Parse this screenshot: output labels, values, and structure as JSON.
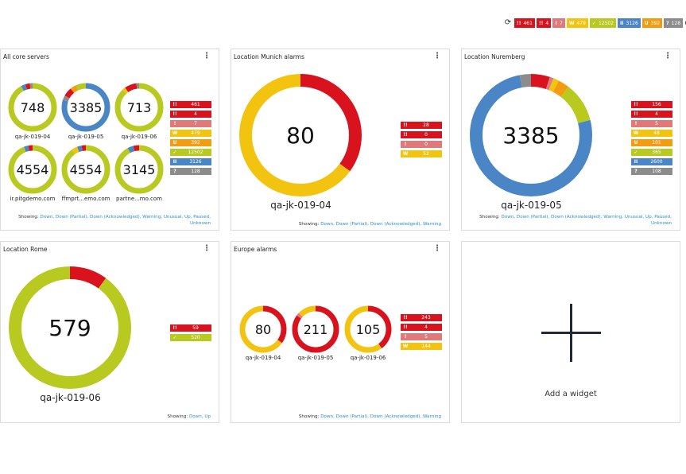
{
  "colors": {
    "down": "#d9131e",
    "partial": "#d9131e",
    "ack": "#e07a7a",
    "warning": "#f2c30f",
    "unusual": "#f39c12",
    "up": "#b8c920",
    "paused": "#4a86c5",
    "unknown": "#8c8c8c"
  },
  "topbar": {
    "refresh_icon": "refresh-icon",
    "counts": [
      {
        "glyph": "!!",
        "value": "461",
        "color": "#d9131e"
      },
      {
        "glyph": "!!",
        "value": "4",
        "color": "#d9131e"
      },
      {
        "glyph": "!",
        "value": "7",
        "color": "#e07a7a"
      },
      {
        "glyph": "W",
        "value": "479",
        "color": "#f2c30f"
      },
      {
        "glyph": "✓",
        "value": "12502",
        "color": "#b8c920"
      },
      {
        "glyph": "II",
        "value": "3126",
        "color": "#4a86c5"
      },
      {
        "glyph": "U",
        "value": "392",
        "color": "#f39c12"
      },
      {
        "glyph": "?",
        "value": "128",
        "color": "#8c8c8c"
      }
    ]
  },
  "widgets": {
    "core": {
      "title": "All core servers",
      "donuts": [
        {
          "value": "748",
          "label": "qa-jk-019-04",
          "segments": [
            [
              "#b8c920",
              92
            ],
            [
              "#4a86c5",
              3
            ],
            [
              "#d9131e",
              3
            ],
            [
              "#8c8c8c",
              2
            ]
          ]
        },
        {
          "value": "3385",
          "label": "qa-jk-019-05",
          "segments": [
            [
              "#4a86c5",
              80
            ],
            [
              "#8c8c8c",
              3
            ],
            [
              "#d9131e",
              6
            ],
            [
              "#f39c12",
              4
            ],
            [
              "#b8c920",
              7
            ]
          ]
        },
        {
          "value": "713",
          "label": "qa-jk-019-06",
          "segments": [
            [
              "#b8c920",
              88
            ],
            [
              "#f2c30f",
              2
            ],
            [
              "#d9131e",
              8
            ],
            [
              "#8c8c8c",
              2
            ]
          ]
        },
        {
          "value": "4554",
          "label": "ir.pitgdemo.com",
          "segments": [
            [
              "#b8c920",
              94
            ],
            [
              "#4a86c5",
              3
            ],
            [
              "#d9131e",
              3
            ]
          ]
        },
        {
          "value": "4554",
          "label": "ffmprt...emo.com",
          "segments": [
            [
              "#b8c920",
              90
            ],
            [
              "#f2c30f",
              4
            ],
            [
              "#4a86c5",
              3
            ],
            [
              "#d9131e",
              3
            ]
          ]
        },
        {
          "value": "3145",
          "label": "partne...mo.com",
          "segments": [
            [
              "#b8c920",
              92
            ],
            [
              "#4a86c5",
              4
            ],
            [
              "#d9131e",
              4
            ]
          ]
        }
      ],
      "legend": [
        {
          "glyph": "!!",
          "value": "461",
          "color": "#d9131e"
        },
        {
          "glyph": "!!",
          "value": "4",
          "color": "#d9131e"
        },
        {
          "glyph": "!",
          "value": "7",
          "color": "#e07a7a"
        },
        {
          "glyph": "W",
          "value": "479",
          "color": "#f2c30f"
        },
        {
          "glyph": "U",
          "value": "392",
          "color": "#f39c12"
        },
        {
          "glyph": "✓",
          "value": "12502",
          "color": "#b8c920"
        },
        {
          "glyph": "II",
          "value": "3126",
          "color": "#4a86c5"
        },
        {
          "glyph": "?",
          "value": "128",
          "color": "#8c8c8c"
        }
      ],
      "showing_prefix": "Showing: ",
      "showing_filters": "Down, Down (Partial), Down (Acknowledged), Warning, Unusual, Up, Paused, Unknown"
    },
    "munich": {
      "title": "Location Munich alarms",
      "value": "80",
      "label": "qa-jk-019-04",
      "segments": [
        [
          "#d9131e",
          35
        ],
        [
          "#f2c30f",
          65
        ]
      ],
      "legend": [
        {
          "glyph": "!!",
          "value": "28",
          "color": "#d9131e"
        },
        {
          "glyph": "!!",
          "value": "0",
          "color": "#d9131e"
        },
        {
          "glyph": "!",
          "value": "0",
          "color": "#e07a7a"
        },
        {
          "glyph": "W",
          "value": "52",
          "color": "#f2c30f"
        }
      ],
      "showing_prefix": "Showing: ",
      "showing_filters": "Down, Down (Partial), Down (Acknowledged), Warning"
    },
    "nuremberg": {
      "title": "Location Nuremberg",
      "value": "3385",
      "label": "qa-jk-019-05",
      "segments": [
        [
          "#d9131e",
          5
        ],
        [
          "#e07a7a",
          1
        ],
        [
          "#f2c30f",
          1.5
        ],
        [
          "#f39c12",
          3
        ],
        [
          "#b8c920",
          10.5
        ],
        [
          "#4a86c5",
          76
        ],
        [
          "#8c8c8c",
          3
        ]
      ],
      "legend": [
        {
          "glyph": "!!",
          "value": "156",
          "color": "#d9131e"
        },
        {
          "glyph": "!!",
          "value": "4",
          "color": "#d9131e"
        },
        {
          "glyph": "!",
          "value": "5",
          "color": "#e07a7a"
        },
        {
          "glyph": "W",
          "value": "48",
          "color": "#f2c30f"
        },
        {
          "glyph": "U",
          "value": "101",
          "color": "#f39c12"
        },
        {
          "glyph": "✓",
          "value": "365",
          "color": "#b8c920"
        },
        {
          "glyph": "II",
          "value": "2600",
          "color": "#4a86c5"
        },
        {
          "glyph": "?",
          "value": "108",
          "color": "#8c8c8c"
        }
      ],
      "showing_prefix": "Showing: ",
      "showing_filters": "Down, Down (Partial), Down (Acknowledged), Warning, Unusual, Up, Paused, Unknown"
    },
    "rome": {
      "title": "Location Rome",
      "value": "579",
      "label": "qa-jk-019-06",
      "segments": [
        [
          "#d9131e",
          10
        ],
        [
          "#b8c920",
          90
        ]
      ],
      "legend": [
        {
          "glyph": "!!",
          "value": "59",
          "color": "#d9131e"
        },
        {
          "glyph": "✓",
          "value": "520",
          "color": "#b8c920"
        }
      ],
      "showing_prefix": "Showing: ",
      "showing_filters": "Down, Up"
    },
    "europe": {
      "title": "Europe alarms",
      "donuts": [
        {
          "value": "80",
          "label": "qa-jk-019-04",
          "segments": [
            [
              "#d9131e",
              35
            ],
            [
              "#f2c30f",
              65
            ]
          ]
        },
        {
          "value": "211",
          "label": "qa-jk-019-05",
          "segments": [
            [
              "#d9131e",
              85
            ],
            [
              "#e07a7a",
              2
            ],
            [
              "#f2c30f",
              13
            ]
          ]
        },
        {
          "value": "105",
          "label": "qa-jk-019-06",
          "segments": [
            [
              "#d9131e",
              40
            ],
            [
              "#f2c30f",
              60
            ]
          ]
        }
      ],
      "legend": [
        {
          "glyph": "!!",
          "value": "243",
          "color": "#d9131e"
        },
        {
          "glyph": "!!",
          "value": "4",
          "color": "#d9131e"
        },
        {
          "glyph": "!",
          "value": "5",
          "color": "#e07a7a"
        },
        {
          "glyph": "W",
          "value": "144",
          "color": "#f2c30f"
        }
      ],
      "showing_prefix": "Showing: ",
      "showing_filters": "Down, Down (Partial), Down (Acknowledged), Warning"
    },
    "add": {
      "label": "Add a widget"
    }
  }
}
